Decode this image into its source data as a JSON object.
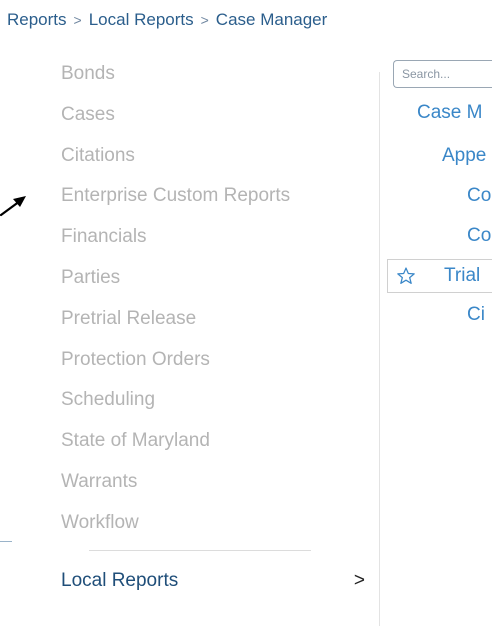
{
  "breadcrumb": {
    "items": [
      "Reports",
      "Local Reports",
      "Case Manager"
    ],
    "separator": ">"
  },
  "categories": [
    "Bonds",
    "Cases",
    "Citations",
    "Enterprise Custom Reports",
    "Financials",
    "Parties",
    "Pretrial Release",
    "Protection Orders",
    "Scheduling",
    "State of Maryland",
    "Warrants",
    "Workflow"
  ],
  "local_reports": {
    "label": "Local Reports",
    "chevron": ">"
  },
  "tree": {
    "search_placeholder": "Search...",
    "nodes": [
      "Case M",
      "Appe",
      "Co",
      "Co",
      "Trial",
      "Ci"
    ],
    "selected_index": 4
  },
  "icons": {
    "star": "star-outline-icon",
    "arrow": "annotation-arrow-icon"
  },
  "colors": {
    "breadcrumb": "#2b5e8c",
    "category_text": "#b4b4b4",
    "local_reports_text": "#1f4e79",
    "tree_link": "#3a87c8"
  }
}
